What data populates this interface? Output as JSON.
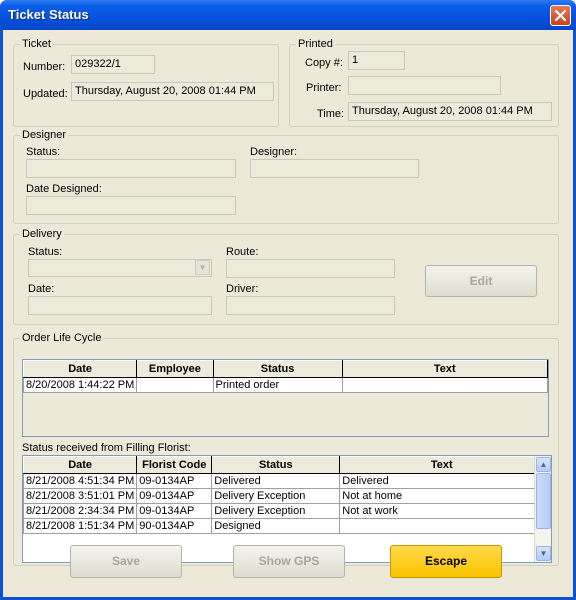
{
  "window": {
    "title": "Ticket Status"
  },
  "ticket": {
    "legend": "Ticket",
    "number_label": "Number:",
    "number_value": "029322/1",
    "updated_label": "Updated:",
    "updated_value": "Thursday, August 20, 2008  01:44 PM"
  },
  "printed": {
    "legend": "Printed",
    "copy_label": "Copy #:",
    "copy_value": "1",
    "printer_label": "Printer:",
    "printer_value": "",
    "time_label": "Time:",
    "time_value": "Thursday, August 20, 2008  01:44 PM"
  },
  "designer": {
    "legend": "Designer",
    "status_label": "Status:",
    "status_value": "",
    "designer_label": "Designer:",
    "designer_value": "",
    "date_label": "Date Designed:",
    "date_value": ""
  },
  "delivery": {
    "legend": "Delivery",
    "status_label": "Status:",
    "status_value": "",
    "route_label": "Route:",
    "route_value": "",
    "date_label": "Date:",
    "date_value": "",
    "driver_label": "Driver:",
    "driver_value": "",
    "edit_label": "Edit"
  },
  "lifecycle": {
    "legend": "Order Life Cycle",
    "columns": [
      "Date",
      "Employee",
      "Status",
      "Text"
    ],
    "rows": [
      [
        "8/20/2008 1:44:22 PM",
        "",
        "Printed order",
        ""
      ]
    ],
    "filling_label": "Status received from Filling Florist:",
    "filling_columns": [
      "Date",
      "Florist Code",
      "Status",
      "Text"
    ],
    "filling_rows": [
      [
        "8/21/2008 4:51:34 PM",
        "09-0134AP",
        "Delivered",
        "Delivered"
      ],
      [
        "8/21/2008 3:51:01 PM",
        "09-0134AP",
        "Delivery Exception",
        "Not at home"
      ],
      [
        "8/21/2008 2:34:34 PM",
        "09-0134AP",
        "Delivery Exception",
        "Not at work"
      ],
      [
        "8/21/2008 1:51:34 PM",
        "90-0134AP",
        "Designed",
        ""
      ]
    ]
  },
  "footer": {
    "save_label": "Save",
    "gps_label": "Show GPS",
    "escape_label": "Escape"
  },
  "colors": {
    "title_bar": "#0551dd",
    "dialog_bg": "#ece9d8",
    "escape_button": "#fbc500",
    "close_button": "#d9512b"
  },
  "icons": {
    "close": "close-icon",
    "combo": "chevron-down-icon",
    "scroll_up": "arrow-up-icon",
    "scroll_down": "arrow-down-icon"
  }
}
